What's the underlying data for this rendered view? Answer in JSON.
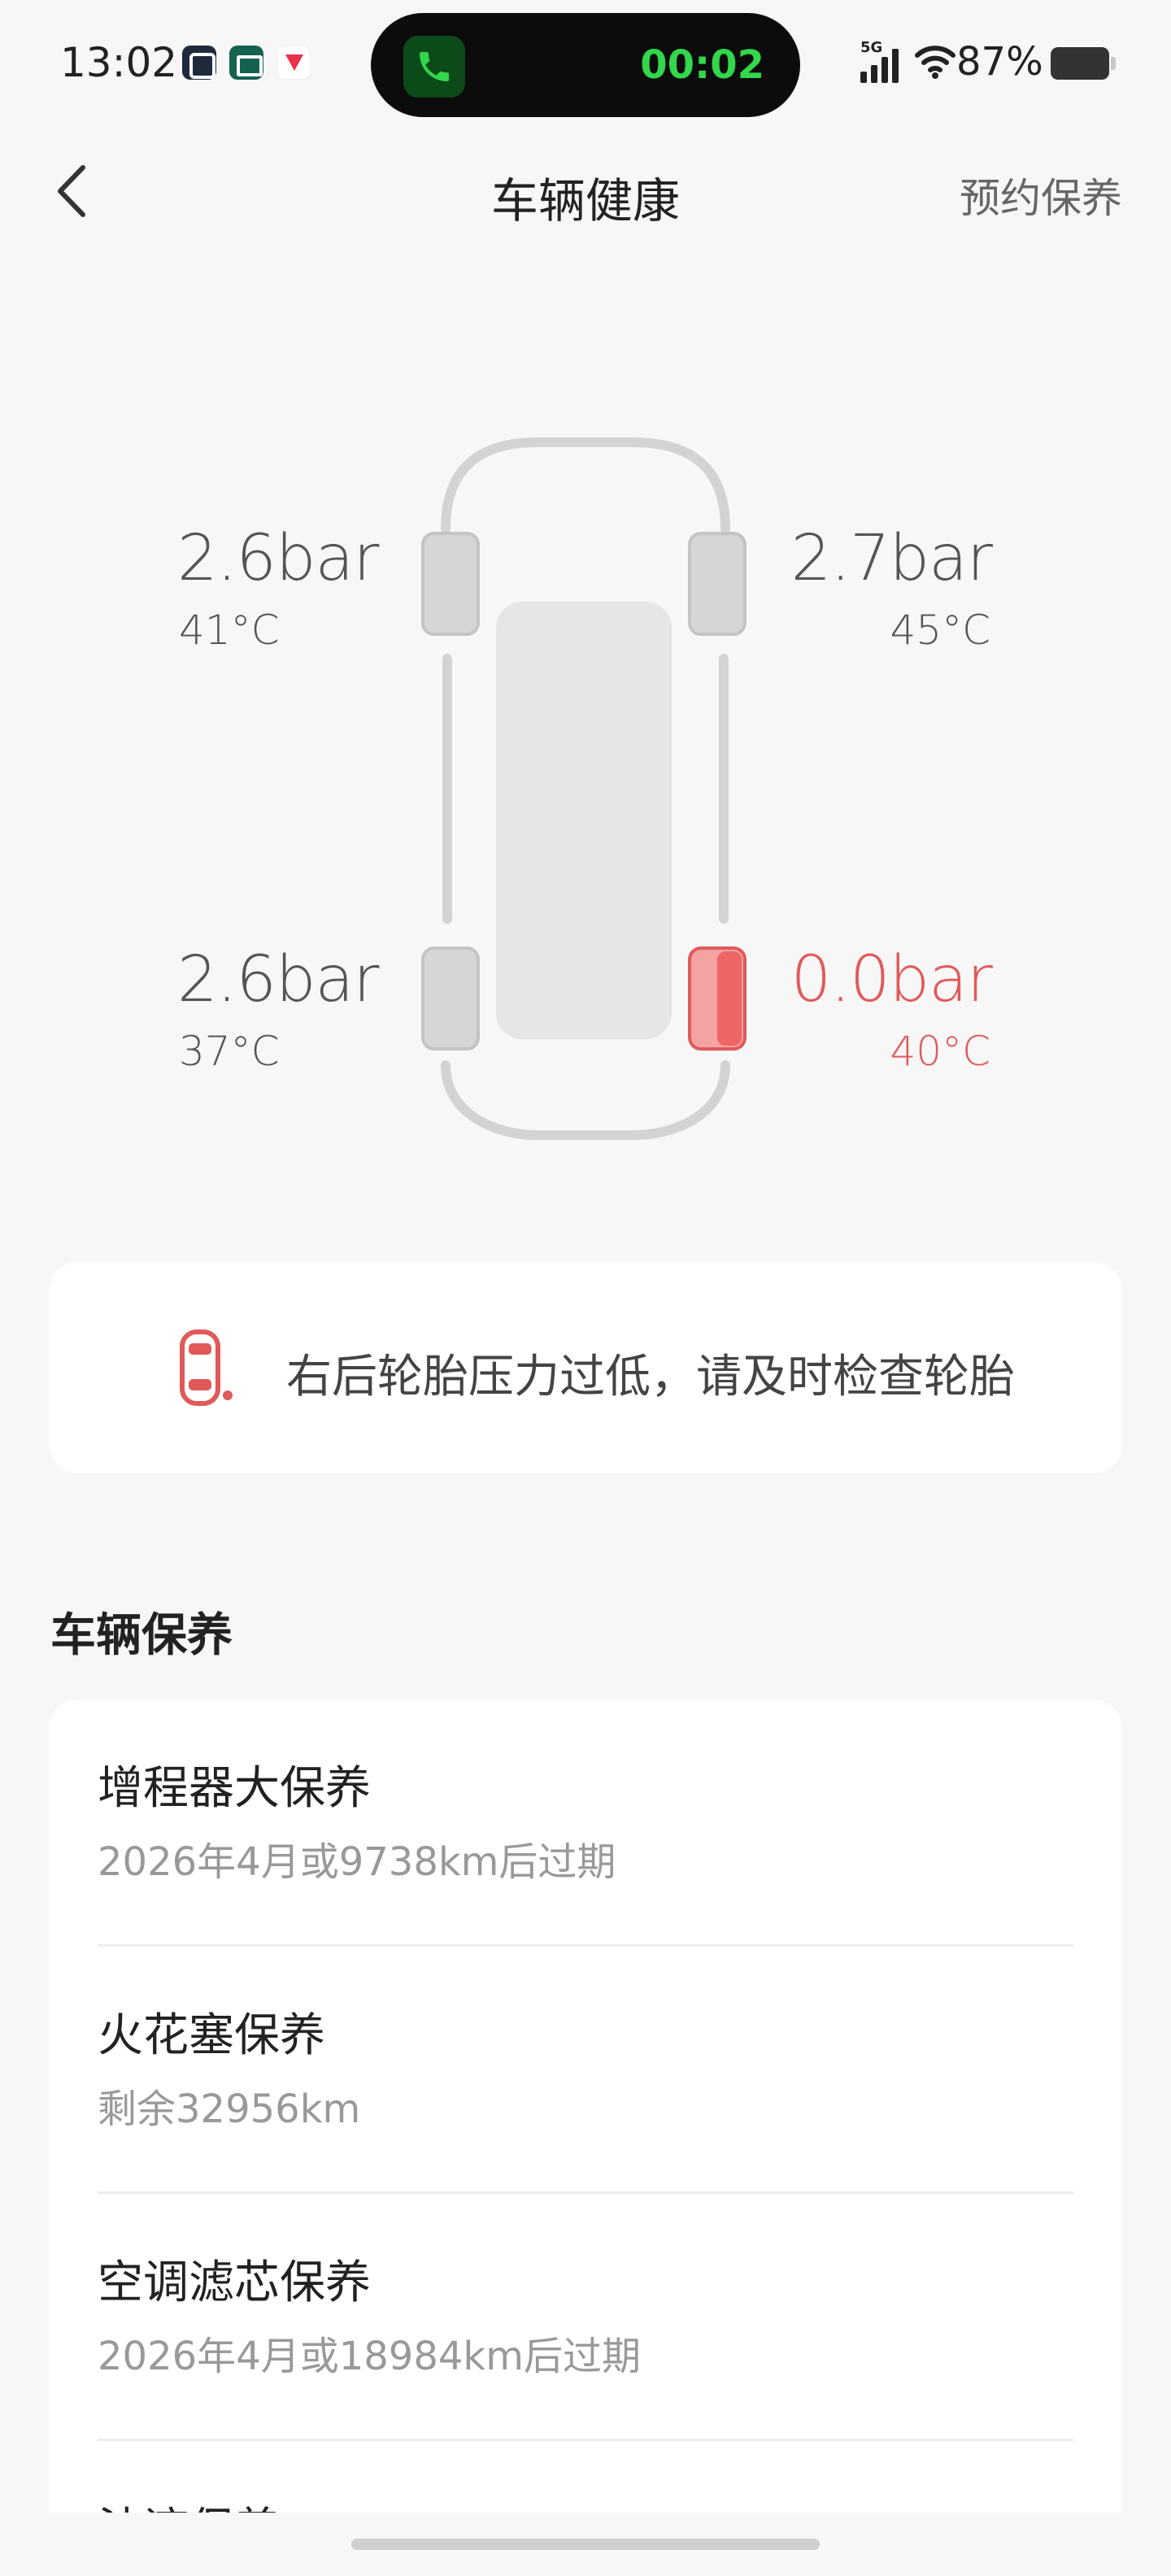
{
  "status_bar": {
    "time": "13:02",
    "call_timer": "00:02",
    "network": "5G",
    "battery_percent": "87%",
    "battery_level": 0.87,
    "app_icons": [
      "mi-icon",
      "green-app-icon",
      "red-app-icon"
    ]
  },
  "nav": {
    "title": "车辆健康",
    "action": "预约保养",
    "back_icon": "chevron-left-icon"
  },
  "tires": {
    "front_left": {
      "pressure": "2.6bar",
      "temp": "41°C",
      "alert": false
    },
    "front_right": {
      "pressure": "2.7bar",
      "temp": "45°C",
      "alert": false
    },
    "rear_left": {
      "pressure": "2.6bar",
      "temp": "37°C",
      "alert": false
    },
    "rear_right": {
      "pressure": "0.0bar",
      "temp": "40°C",
      "alert": true
    }
  },
  "alert": {
    "message": "右后轮胎压力过低，请及时检查轮胎",
    "icon": "tire-warning-icon"
  },
  "maintenance": {
    "title": "车辆保养",
    "items": [
      {
        "name": "增程器大保养",
        "detail": "2026年4月或9738km后过期"
      },
      {
        "name": "火花塞保养",
        "detail": "剩余32956km"
      },
      {
        "name": "空调滤芯保养",
        "detail": "2026年4月或18984km后过期"
      },
      {
        "name": "油液保养",
        "detail": ""
      }
    ]
  },
  "colors": {
    "background": "#f7f7f7",
    "card": "#ffffff",
    "alert_red": "#e05a5a",
    "tire_gray": "#d6d6d6",
    "call_green": "#32d74b"
  }
}
